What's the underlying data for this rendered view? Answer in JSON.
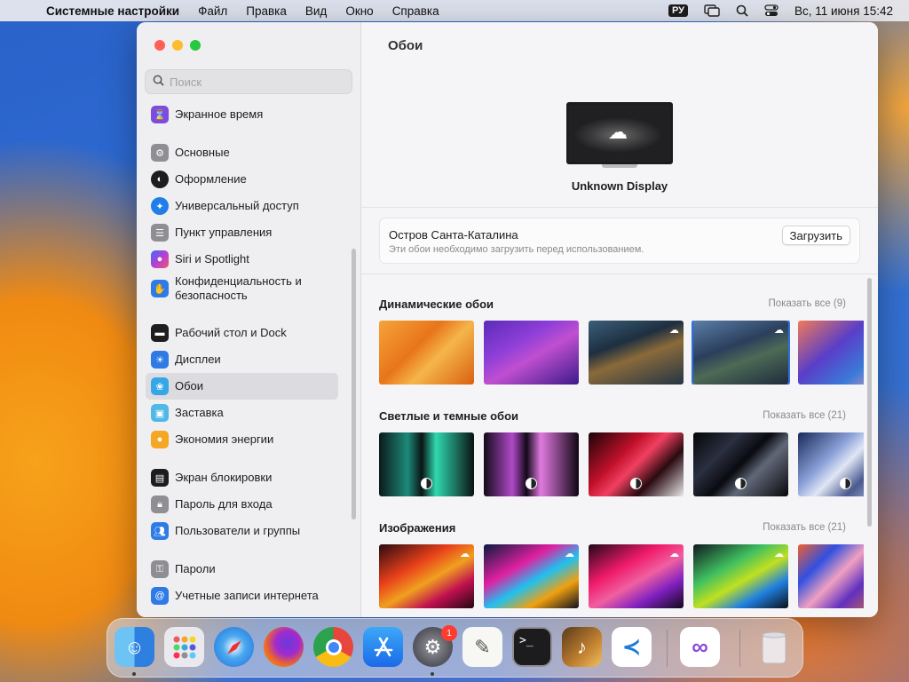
{
  "menubar": {
    "app_name": "Системные настройки",
    "menus": [
      "Файл",
      "Правка",
      "Вид",
      "Окно",
      "Справка"
    ],
    "keyboard_layout": "РУ",
    "clock": "Вс, 11 июня  15:42"
  },
  "sidebar": {
    "search_placeholder": "Поиск",
    "items": [
      {
        "label": "Экранное время",
        "icon": "hourglass-icon",
        "color": "#7c4be0"
      },
      {
        "label": "Основные",
        "icon": "gear-icon",
        "color": "#8e8e93"
      },
      {
        "label": "Оформление",
        "icon": "appearance-icon",
        "color": "#1d1d1f"
      },
      {
        "label": "Универсальный доступ",
        "icon": "accessibility-icon",
        "color": "#1f7ee8"
      },
      {
        "label": "Пункт управления",
        "icon": "control-center-icon",
        "color": "#8e8e93"
      },
      {
        "label": "Siri и Spotlight",
        "icon": "siri-icon",
        "color": "#b43fd6"
      },
      {
        "label": "Конфиденциальность и безопасность",
        "icon": "hand-icon",
        "color": "#2f7be6"
      },
      {
        "label": "Рабочий стол и Dock",
        "icon": "dock-icon",
        "color": "#1d1d1f"
      },
      {
        "label": "Дисплеи",
        "icon": "display-sun-icon",
        "color": "#2f7be6"
      },
      {
        "label": "Обои",
        "icon": "wallpaper-icon",
        "color": "#35a7e8"
      },
      {
        "label": "Заставка",
        "icon": "screensaver-icon",
        "color": "#4fb8e6"
      },
      {
        "label": "Экономия энергии",
        "icon": "battery-icon",
        "color": "#f5a623"
      },
      {
        "label": "Экран блокировки",
        "icon": "lock-screen-icon",
        "color": "#1d1d1f"
      },
      {
        "label": "Пароль для входа",
        "icon": "lock-icon",
        "color": "#8e8e93"
      },
      {
        "label": "Пользователи и группы",
        "icon": "users-icon",
        "color": "#2f7be6"
      },
      {
        "label": "Пароли",
        "icon": "key-icon",
        "color": "#8e8e93"
      },
      {
        "label": "Учетные записи интернета",
        "icon": "at-icon",
        "color": "#2f7be6"
      }
    ]
  },
  "main": {
    "title": "Обои",
    "display_name": "Unknown Display",
    "download": {
      "title": "Остров Санта-Каталина",
      "subtitle": "Эти обои необходимо загрузить перед использованием.",
      "button": "Загрузить"
    },
    "sections": [
      {
        "title": "Динамические обои",
        "show_all": "Показать все (9)"
      },
      {
        "title": "Светлые и темные обои",
        "show_all": "Показать все (21)"
      },
      {
        "title": "Изображения",
        "show_all": "Показать все (21)"
      }
    ]
  },
  "dock": {
    "apps": [
      "finder-icon",
      "launchpad-icon",
      "safari-icon",
      "firefox-icon",
      "chrome-icon",
      "app-store-icon",
      "system-settings-icon",
      "textedit-icon",
      "terminal-icon",
      "garageband-icon",
      "vscode-icon",
      "visual-studio-icon",
      "trash-icon"
    ],
    "settings_badge": "1"
  }
}
